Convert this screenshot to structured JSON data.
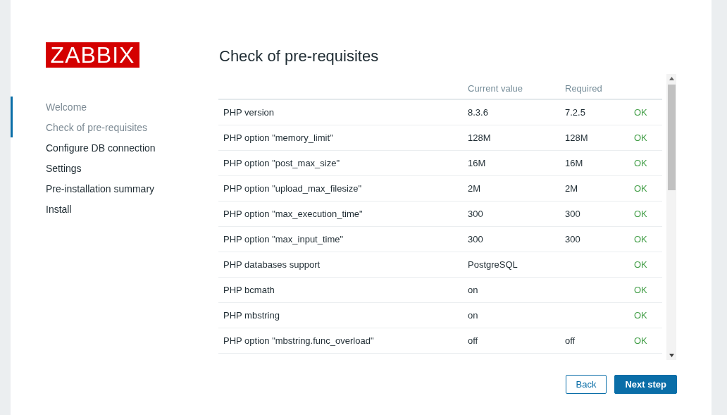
{
  "logo": "ZABBIX",
  "steps": [
    {
      "label": "Welcome",
      "completed": true
    },
    {
      "label": "Check of pre-requisites",
      "completed": true
    },
    {
      "label": "Configure DB connection",
      "completed": false
    },
    {
      "label": "Settings",
      "completed": false
    },
    {
      "label": "Pre-installation summary",
      "completed": false
    },
    {
      "label": "Install",
      "completed": false
    }
  ],
  "title": "Check of pre-requisites",
  "table": {
    "columns": [
      "Current value",
      "Required"
    ],
    "rows": [
      {
        "name": "PHP version",
        "current": "8.3.6",
        "required": "7.2.5",
        "status": "OK",
        "ok": true
      },
      {
        "name": "PHP option \"memory_limit\"",
        "current": "128M",
        "required": "128M",
        "status": "OK",
        "ok": true
      },
      {
        "name": "PHP option \"post_max_size\"",
        "current": "16M",
        "required": "16M",
        "status": "OK",
        "ok": true
      },
      {
        "name": "PHP option \"upload_max_filesize\"",
        "current": "2M",
        "required": "2M",
        "status": "OK",
        "ok": true
      },
      {
        "name": "PHP option \"max_execution_time\"",
        "current": "300",
        "required": "300",
        "status": "OK",
        "ok": true
      },
      {
        "name": "PHP option \"max_input_time\"",
        "current": "300",
        "required": "300",
        "status": "OK",
        "ok": true
      },
      {
        "name": "PHP databases support",
        "current": "PostgreSQL",
        "status": "OK",
        "ok": true
      },
      {
        "name": "PHP bcmath",
        "current": "on",
        "status": "OK",
        "ok": true
      },
      {
        "name": "PHP mbstring",
        "current": "on",
        "status": "OK",
        "ok": true
      },
      {
        "name": "PHP option \"mbstring.func_overload\"",
        "current": "off",
        "required": "off",
        "status": "OK",
        "ok": true
      }
    ]
  },
  "buttons": {
    "back": "Back",
    "next": "Next step"
  }
}
